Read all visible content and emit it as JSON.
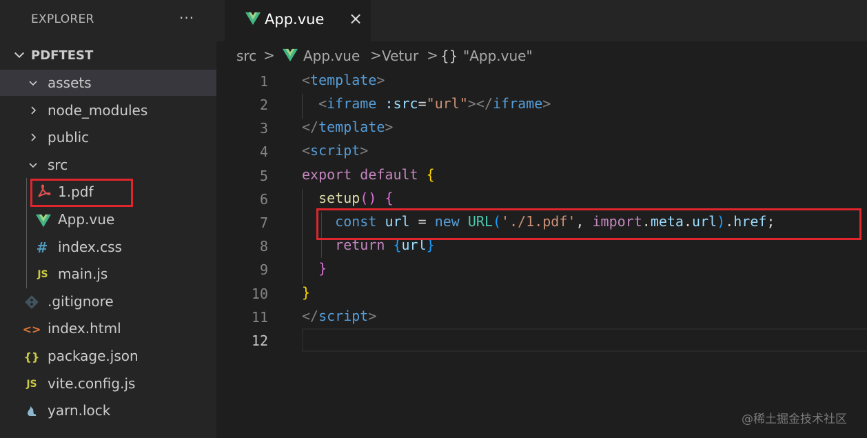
{
  "explorer": {
    "title": "EXPLORER",
    "more_label": "···",
    "project": "PDFTEST",
    "tree": [
      {
        "label": "assets",
        "kind": "folder",
        "open": true,
        "icon": "chevron-down-icon"
      },
      {
        "label": "node_modules",
        "kind": "folder",
        "open": false,
        "icon": "chevron-right-icon"
      },
      {
        "label": "public",
        "kind": "folder",
        "open": false,
        "icon": "chevron-right-icon"
      },
      {
        "label": "src",
        "kind": "folder",
        "open": true,
        "icon": "chevron-down-icon"
      },
      {
        "label": "1.pdf",
        "kind": "file",
        "icon": "pdf-icon"
      },
      {
        "label": "App.vue",
        "kind": "file",
        "icon": "vue-icon"
      },
      {
        "label": "index.css",
        "kind": "file",
        "icon": "css-hash-icon",
        "glyph": "#"
      },
      {
        "label": "main.js",
        "kind": "file",
        "icon": "js-icon",
        "glyph": "JS"
      },
      {
        "label": ".gitignore",
        "kind": "file",
        "icon": "git-icon"
      },
      {
        "label": "index.html",
        "kind": "file",
        "icon": "html-icon",
        "glyph": "<>"
      },
      {
        "label": "package.json",
        "kind": "file",
        "icon": "json-braces-icon",
        "glyph": "{}"
      },
      {
        "label": "vite.config.js",
        "kind": "file",
        "icon": "js-icon",
        "glyph": "JS"
      },
      {
        "label": "yarn.lock",
        "kind": "file",
        "icon": "yarn-icon"
      }
    ]
  },
  "tab": {
    "label": "App.vue",
    "close": "×",
    "icon": "vue-icon"
  },
  "breadcrumb": {
    "items": [
      "src",
      "App.vue",
      "Vetur",
      "\"App.vue\""
    ],
    "separator": ">",
    "braces": "{}"
  },
  "line_numbers": [
    "1",
    "2",
    "3",
    "4",
    "5",
    "6",
    "7",
    "8",
    "9",
    "10",
    "11",
    "12"
  ],
  "code": {
    "l1": {
      "open": "<",
      "tag": "template",
      "close": ">"
    },
    "l2": {
      "open": "<",
      "tag": "iframe",
      "attr": ":src",
      "eq": "=",
      "val": "\"url\"",
      "gt": ">",
      "close_open": "</",
      "close_tag": "iframe",
      "close_gt": ">"
    },
    "l3": {
      "open": "</",
      "tag": "template",
      "close": ">"
    },
    "l4": {
      "open": "<",
      "tag": "script",
      "close": ">"
    },
    "l5": {
      "export": "export",
      "default": "default",
      "brace": "{"
    },
    "l6": {
      "fn": "setup",
      "parens": "()",
      "brace": "{"
    },
    "l7": {
      "const": "const",
      "var": "url",
      "eq": "=",
      "new": "new",
      "cls": "URL",
      "p_open": "(",
      "str": "'./1.pdf'",
      "comma": ",",
      "import": "import",
      "dot1": ".",
      "meta": "meta",
      "dot2": ".",
      "url": "url",
      "p_close": ")",
      "dot3": ".",
      "href": "href",
      "semi": ";"
    },
    "l8": {
      "kw": "return",
      "b_open": "{",
      "var": "url",
      "b_close": "}"
    },
    "l9": {
      "brace": "}"
    },
    "l10": {
      "brace": "}"
    },
    "l11": {
      "open": "</",
      "tag": "script",
      "close": ">"
    }
  },
  "watermark": "@稀土掘金技术社区",
  "colors": {
    "accent_annotation": "#e0262c",
    "vue_green": "#41b883"
  }
}
